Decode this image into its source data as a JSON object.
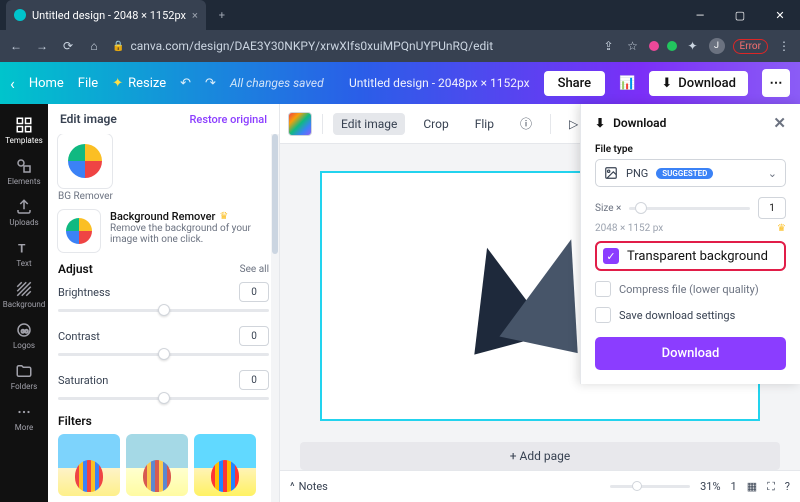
{
  "browser": {
    "tab_title": "Untitled design - 2048 × 1152px",
    "url": "canva.com/design/DAE3Y30NKPY/xrwXIfs0xuiMPQnUYPUnRQ/edit",
    "error_label": "Error"
  },
  "canvabar": {
    "home": "Home",
    "file": "File",
    "resize": "Resize",
    "autosave": "All changes saved",
    "doc_title": "Untitled design - 2048px × 1152px",
    "share": "Share",
    "download": "Download"
  },
  "rail": {
    "templates": "Templates",
    "elements": "Elements",
    "uploads": "Uploads",
    "text": "Text",
    "background": "Background",
    "logos": "Logos",
    "folders": "Folders",
    "more": "More"
  },
  "panel": {
    "title": "Edit image",
    "restore": "Restore original",
    "bgremover_thumb": "BG Remover",
    "bgremover_title": "Background Remover",
    "bgremover_desc": "Remove the background of your image with one click.",
    "adjust": "Adjust",
    "seeall": "See all",
    "brightness": "Brightness",
    "brightness_val": "0",
    "contrast": "Contrast",
    "contrast_val": "0",
    "saturation": "Saturation",
    "saturation_val": "0",
    "filters": "Filters"
  },
  "toolbar": {
    "edit_image": "Edit image",
    "crop": "Crop",
    "flip": "Flip",
    "animate": "Animate"
  },
  "canvas": {
    "add_page": "+ Add page"
  },
  "bottom": {
    "notes": "Notes",
    "zoom": "31%",
    "page": "1"
  },
  "download": {
    "title": "Download",
    "file_type_label": "File type",
    "file_type": "PNG",
    "suggested": "SUGGESTED",
    "size_label": "Size ×",
    "size_val": "1",
    "dimensions": "2048 × 1152 px",
    "transparent": "Transparent background",
    "compress": "Compress file (lower quality)",
    "save_settings": "Save download settings",
    "button": "Download"
  }
}
